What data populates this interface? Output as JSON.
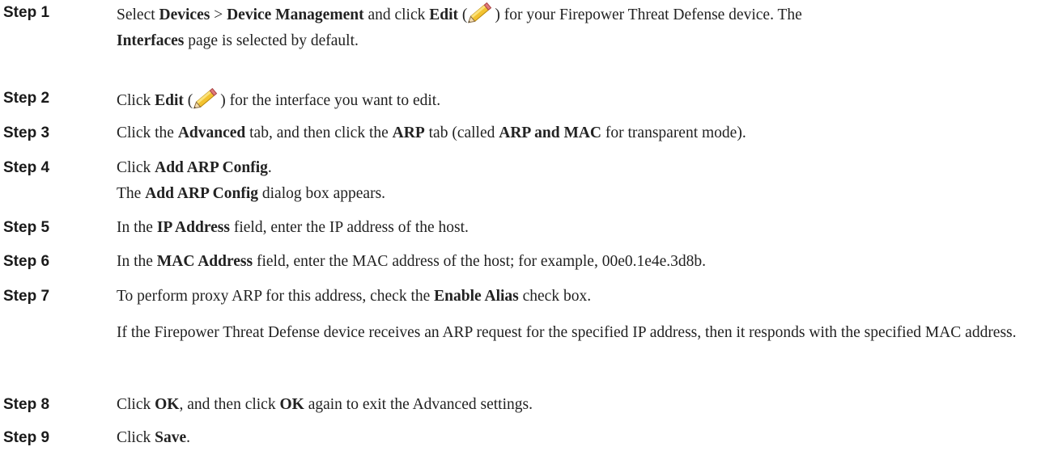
{
  "step_prefix": "Step",
  "steps": [
    {
      "label": "Step 1",
      "t1": "Select ",
      "b1": "Devices",
      "t2": " > ",
      "b2": "Device Management",
      "t3": " and click ",
      "b3": "Edit",
      "t4": " (",
      "t5": ") for your Firepower Threat Defense device. The",
      "b4": "Interfaces",
      "t6": " page is selected by default."
    },
    {
      "label": "Step 2",
      "t1": "Click ",
      "b1": "Edit",
      "t2": " (",
      "t3": ") for the interface you want to edit."
    },
    {
      "label": "Step 3",
      "t1": "Click the ",
      "b1": "Advanced",
      "t2": " tab, and then click the ",
      "b2": "ARP",
      "t3": " tab (called ",
      "b3": "ARP and MAC",
      "t4": " for transparent mode)."
    },
    {
      "label": "Step 4",
      "t1": "Click ",
      "b1": "Add ARP Config",
      "t2": ".",
      "t3": "The ",
      "b2": "Add ARP Config",
      "t4": " dialog box appears."
    },
    {
      "label": "Step 5",
      "t1": "In the ",
      "b1": "IP Address",
      "t2": " field, enter the IP address of the host."
    },
    {
      "label": "Step 6",
      "t1": "In the ",
      "b1": "MAC Address",
      "t2": " field, enter the MAC address of the host; for example, 00e0.1e4e.3d8b."
    },
    {
      "label": "Step 7",
      "t1": "To perform proxy ARP for this address, check the ",
      "b1": "Enable Alias",
      "t2": " check box.",
      "para": "If the Firepower Threat Defense device receives an ARP request for the specified IP address, then it responds with the specified MAC address."
    },
    {
      "label": "Step 8",
      "t1": "Click ",
      "b1": "OK",
      "t2": ", and then click ",
      "b2": "OK",
      "t3": " again to exit the Advanced settings."
    },
    {
      "label": "Step 9",
      "t1": "Click ",
      "b1": "Save",
      "t2": "."
    }
  ],
  "icons": {
    "edit": "pencil-icon"
  }
}
